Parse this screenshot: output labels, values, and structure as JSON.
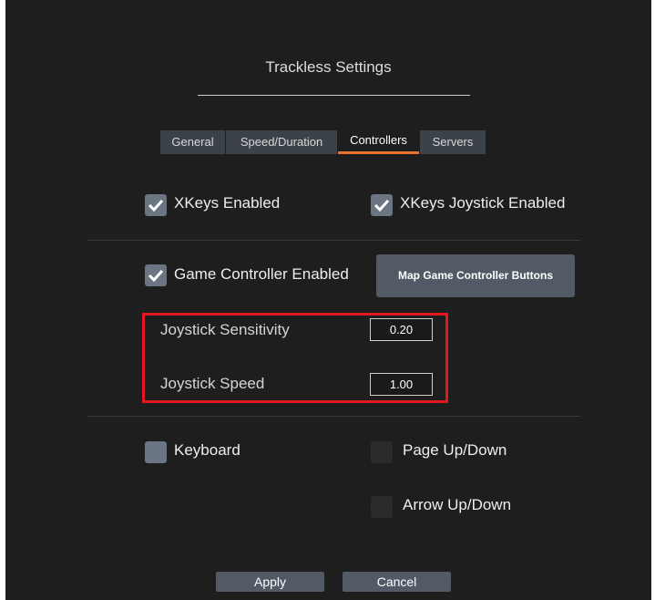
{
  "dialog": {
    "title": "Trackless Settings"
  },
  "tabs": [
    {
      "label": "General",
      "active": false
    },
    {
      "label": "Speed/Duration",
      "active": false
    },
    {
      "label": "Controllers",
      "active": true
    },
    {
      "label": "Servers",
      "active": false
    }
  ],
  "controllers": {
    "xkeys_enabled": {
      "label": "XKeys Enabled",
      "checked": true
    },
    "xkeys_joystick_enabled": {
      "label": "XKeys Joystick Enabled",
      "checked": true
    },
    "game_controller_enabled": {
      "label": "Game Controller Enabled",
      "checked": true
    },
    "map_button_label": "Map Game Controller Buttons",
    "joystick_sensitivity": {
      "label": "Joystick Sensitivity",
      "value": "0.20"
    },
    "joystick_speed": {
      "label": "Joystick Speed",
      "value": "1.00"
    },
    "keyboard": {
      "label": "Keyboard",
      "checked": false
    },
    "page_updown": {
      "label": "Page Up/Down",
      "checked": false
    },
    "arrow_updown": {
      "label": "Arrow Up/Down",
      "checked": false
    }
  },
  "buttons": {
    "apply": "Apply",
    "cancel": "Cancel"
  },
  "colors": {
    "accent": "#e8722a",
    "highlight": "#e4191f",
    "background": "#1e1e1e"
  }
}
